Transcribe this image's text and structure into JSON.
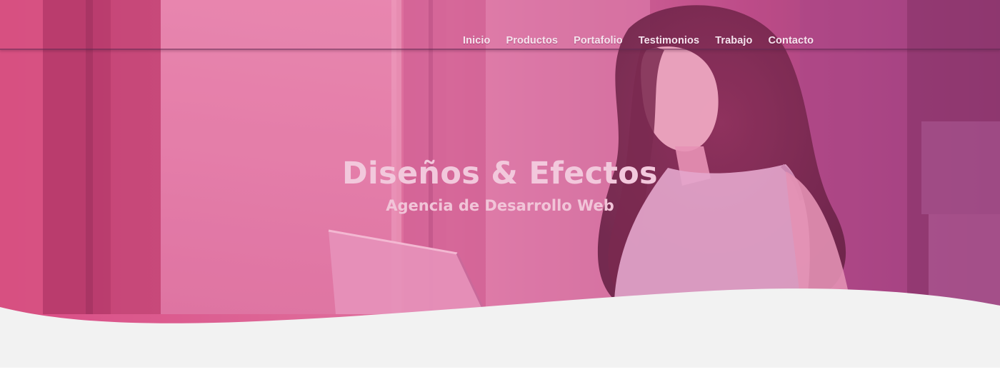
{
  "nav": {
    "items": [
      {
        "label": "Inicio"
      },
      {
        "label": "Productos"
      },
      {
        "label": "Portafolio"
      },
      {
        "label": "Testimonios"
      },
      {
        "label": "Trabajo"
      },
      {
        "label": "Contacto"
      }
    ]
  },
  "hero": {
    "title": "Diseños & Efectos",
    "subtitle": "Agencia de Desarrollo Web",
    "overlay_color": "#d94f8f",
    "overlay_color_right": "#8a2f6c",
    "wave_fill": "#f2f2f2"
  }
}
